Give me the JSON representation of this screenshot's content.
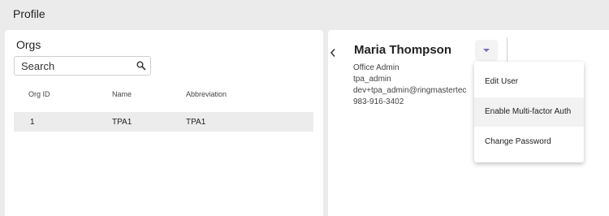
{
  "header": {
    "title": "Profile"
  },
  "orgs": {
    "heading": "Orgs",
    "search": {
      "placeholder": "Search",
      "value": ""
    },
    "columns": [
      "Org ID",
      "Name",
      "Abbreviation"
    ],
    "rows": [
      {
        "org_id": "1",
        "name": "TPA1",
        "abbreviation": "TPA1"
      }
    ]
  },
  "user": {
    "back_icon": "chevron-left-icon",
    "name": "Maria Thompson",
    "role": "Office Admin",
    "username": "tpa_admin",
    "email": "dev+tpa_admin@ringmastertec",
    "phone": "983-916-3402"
  },
  "menu": {
    "items": [
      {
        "label": "Edit User"
      },
      {
        "label": "Enable Multi-factor Auth"
      },
      {
        "label": "Change Password"
      }
    ],
    "highlighted_index": 1
  },
  "colors": {
    "background": "#ebebeb",
    "caret": "#7b6fa8",
    "row_highlight": "#ececec"
  }
}
